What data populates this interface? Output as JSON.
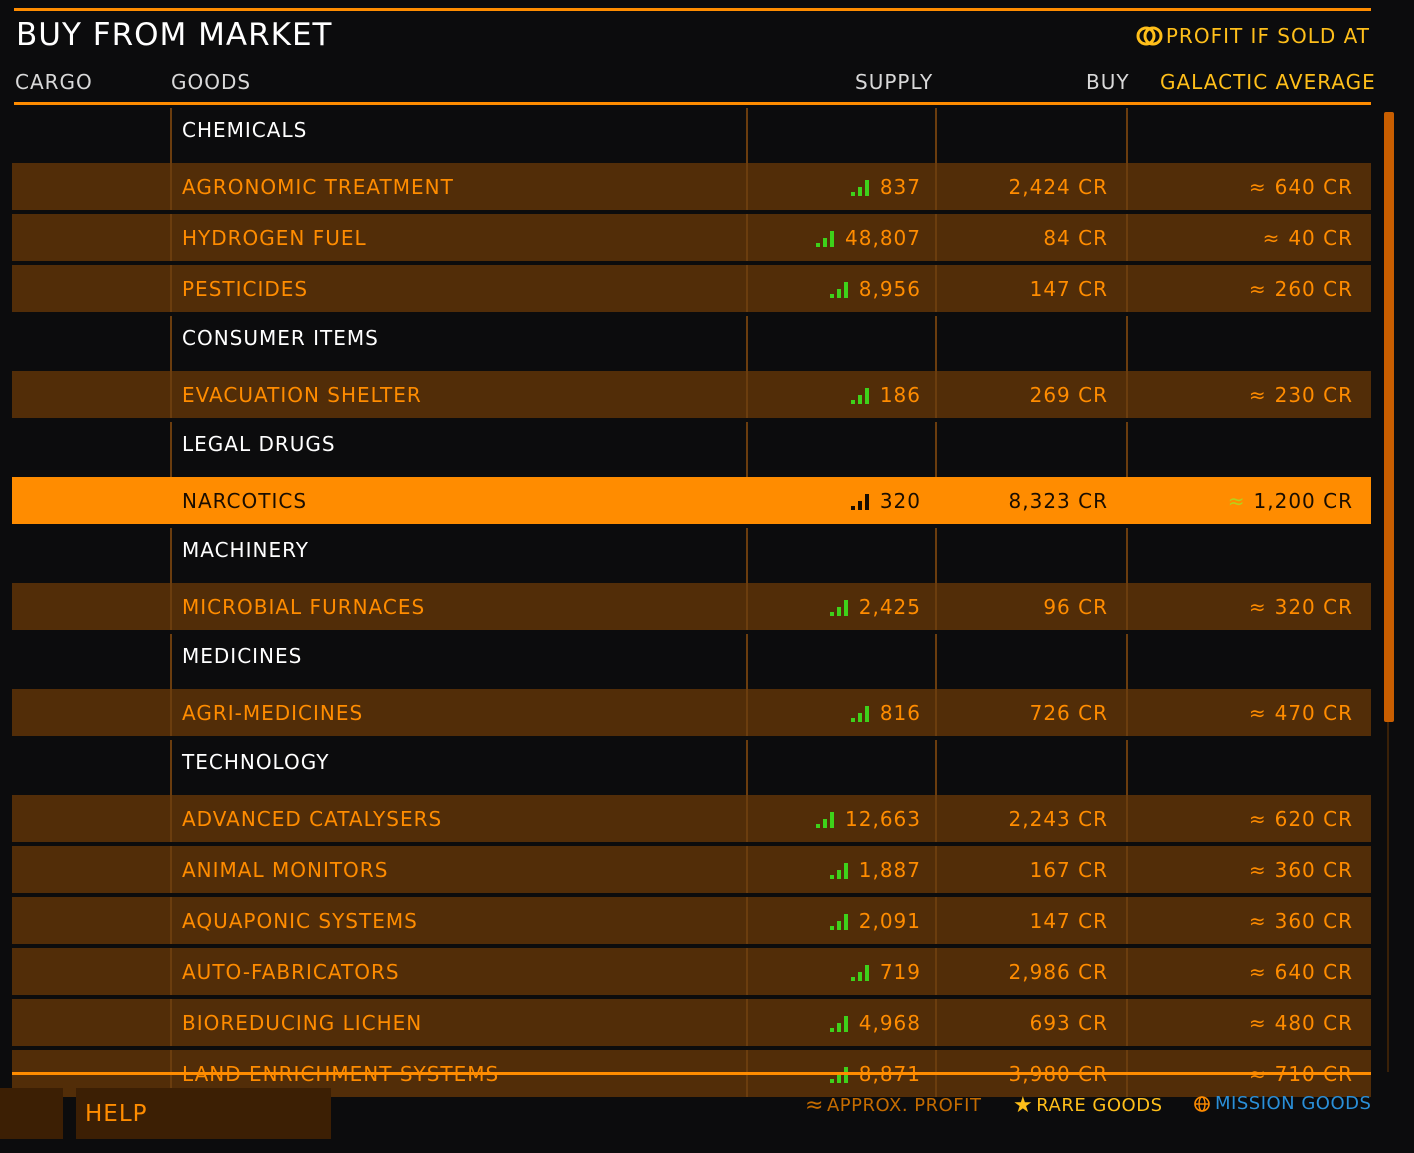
{
  "header": {
    "title": "BUY FROM MARKET",
    "profit_legend": "PROFIT IF SOLD AT"
  },
  "columns": {
    "cargo": "CARGO",
    "goods": "GOODS",
    "supply": "SUPPLY",
    "buy": "BUY",
    "galactic_average": "GALACTIC AVERAGE"
  },
  "colors": {
    "accent": "#ff8c00",
    "row_bg": "#522d08",
    "category_text": "#ffffff",
    "supply_bars": "#3ed11a",
    "mission_blue": "#2a8fd8",
    "rare_yellow": "#ffbf1a"
  },
  "approx_symbol": "≈",
  "market": [
    {
      "category": "CHEMICALS",
      "items": [
        {
          "name": "AGRONOMIC TREATMENT",
          "supply": "837",
          "buy": "2,424 CR",
          "avg": "640 CR"
        },
        {
          "name": "HYDROGEN FUEL",
          "supply": "48,807",
          "buy": "84 CR",
          "avg": "40 CR"
        },
        {
          "name": "PESTICIDES",
          "supply": "8,956",
          "buy": "147 CR",
          "avg": "260 CR"
        }
      ]
    },
    {
      "category": "CONSUMER ITEMS",
      "items": [
        {
          "name": "EVACUATION SHELTER",
          "supply": "186",
          "buy": "269 CR",
          "avg": "230 CR"
        }
      ]
    },
    {
      "category": "LEGAL DRUGS",
      "items": [
        {
          "name": "NARCOTICS",
          "supply": "320",
          "buy": "8,323 CR",
          "avg": "1,200 CR",
          "selected": true
        }
      ]
    },
    {
      "category": "MACHINERY",
      "items": [
        {
          "name": "MICROBIAL FURNACES",
          "supply": "2,425",
          "buy": "96 CR",
          "avg": "320 CR"
        }
      ]
    },
    {
      "category": "MEDICINES",
      "items": [
        {
          "name": "AGRI-MEDICINES",
          "supply": "816",
          "buy": "726 CR",
          "avg": "470 CR"
        }
      ]
    },
    {
      "category": "TECHNOLOGY",
      "items": [
        {
          "name": "ADVANCED CATALYSERS",
          "supply": "12,663",
          "buy": "2,243 CR",
          "avg": "620 CR"
        },
        {
          "name": "ANIMAL MONITORS",
          "supply": "1,887",
          "buy": "167 CR",
          "avg": "360 CR"
        },
        {
          "name": "AQUAPONIC SYSTEMS",
          "supply": "2,091",
          "buy": "147 CR",
          "avg": "360 CR"
        },
        {
          "name": "AUTO-FABRICATORS",
          "supply": "719",
          "buy": "2,986 CR",
          "avg": "640 CR"
        },
        {
          "name": "BIOREDUCING LICHEN",
          "supply": "4,968",
          "buy": "693 CR",
          "avg": "480 CR"
        },
        {
          "name": "LAND ENRICHMENT SYSTEMS",
          "supply": "8,871",
          "buy": "3,980 CR",
          "avg": "710 CR"
        }
      ]
    }
  ],
  "footer": {
    "help_label": "HELP",
    "legend_approx": "APPROX. PROFIT",
    "legend_rare": "RARE GOODS",
    "legend_mission": "MISSION GOODS"
  }
}
